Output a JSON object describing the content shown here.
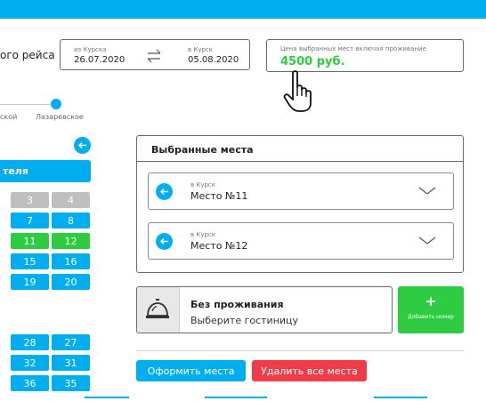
{
  "colors": {
    "accent": "#00aeef",
    "success": "#2ecc40",
    "danger": "#ee3d48",
    "seat_unavailable": "#bfbfbf"
  },
  "trip": {
    "title_fragment": "ого рейса"
  },
  "route": {
    "from_label": "из Курска",
    "from_date": "26.07.2020",
    "to_label": "в Курск",
    "to_date": "05.08.2020",
    "swap_icon": "swap-arrows-icon"
  },
  "price": {
    "caption": "Цена выбранных мест включая проживание",
    "value": "4500 руб."
  },
  "stops": {
    "left_fragment": "ской",
    "current": "Лазаревское"
  },
  "hotel_tab": {
    "label_fragment": "теля"
  },
  "seats": [
    {
      "label": "3",
      "state": "unavailable"
    },
    {
      "label": "4",
      "state": "unavailable"
    },
    {
      "label": "7",
      "state": "available"
    },
    {
      "label": "8",
      "state": "available"
    },
    {
      "label": "11",
      "state": "selected"
    },
    {
      "label": "12",
      "state": "selected"
    },
    {
      "label": "15",
      "state": "available"
    },
    {
      "label": "16",
      "state": "available"
    },
    {
      "label": "19",
      "state": "available"
    },
    {
      "label": "20",
      "state": "available"
    },
    {
      "label": "28",
      "state": "available"
    },
    {
      "label": "27",
      "state": "available"
    },
    {
      "label": "32",
      "state": "available"
    },
    {
      "label": "31",
      "state": "available"
    },
    {
      "label": "36",
      "state": "available"
    },
    {
      "label": "35",
      "state": "available"
    }
  ],
  "selected_panel": {
    "title": "Выбранные места",
    "items": [
      {
        "direction": "в Курск",
        "seat": "Место №11"
      },
      {
        "direction": "в Курск",
        "seat": "Место №12"
      }
    ]
  },
  "accommodation": {
    "title": "Без проживания",
    "subtitle": "Выберите гостиницу",
    "icon": "reception-bell-icon"
  },
  "add_room": {
    "plus": "+",
    "label": "Добавить номер"
  },
  "actions": {
    "book": "Оформить места",
    "clear": "Удалить все места"
  }
}
